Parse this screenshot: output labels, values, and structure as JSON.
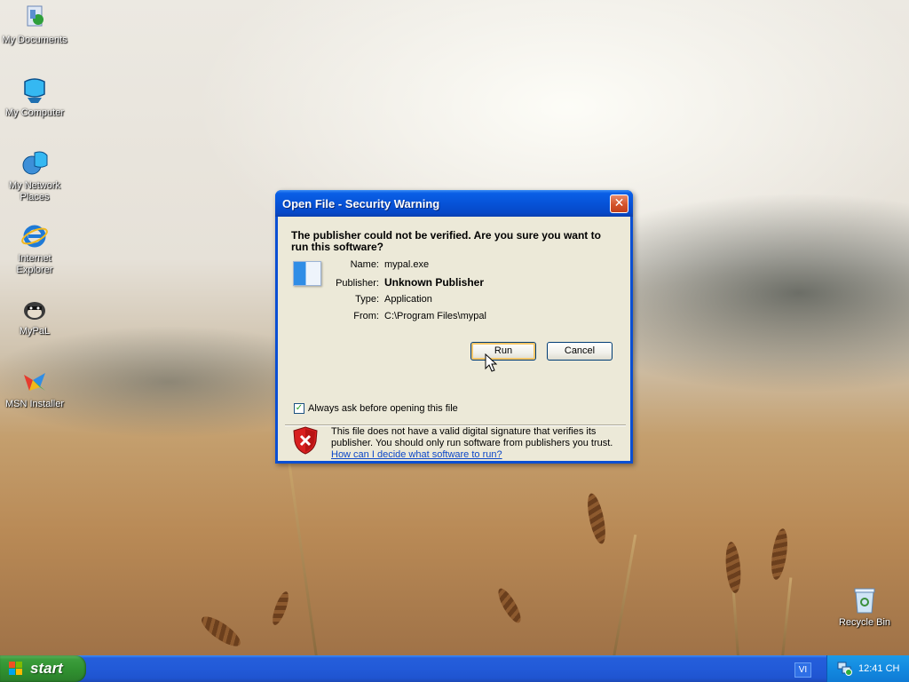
{
  "desktop": {
    "icons": [
      {
        "label": "My Documents",
        "icon": "my-documents-icon"
      },
      {
        "label": "My Computer",
        "icon": "my-computer-icon"
      },
      {
        "label": "My Network Places",
        "icon": "network-places-icon"
      },
      {
        "label": "Internet Explorer",
        "icon": "internet-explorer-icon"
      },
      {
        "label": "MyPaL",
        "icon": "mypal-icon"
      },
      {
        "label": "MSN Installer",
        "icon": "msn-icon"
      },
      {
        "label": "Recycle Bin",
        "icon": "recycle-bin-icon"
      }
    ]
  },
  "dialog": {
    "title": "Open File - Security Warning",
    "close_glyph": "✕",
    "headline": "The publisher could not be verified.  Are you sure you want to run this software?",
    "fields": [
      {
        "key": "Name:",
        "value": "mypal.exe"
      },
      {
        "key": "Publisher:",
        "value": "Unknown Publisher"
      },
      {
        "key": "Type:",
        "value": "Application"
      },
      {
        "key": "From:",
        "value": "C:\\Program Files\\mypal"
      }
    ],
    "run_label": "Run",
    "cancel_label": "Cancel",
    "checkbox_label": "Always ask before opening this file",
    "checkbox_checked": true,
    "warning_text": "This file does not have a valid digital signature that verifies its publisher.  You should only run software from publishers you trust.",
    "warning_link": "How can I decide what software to run?"
  },
  "taskbar": {
    "start_label": "start",
    "language": "VI",
    "clock": "12:41 CH"
  }
}
